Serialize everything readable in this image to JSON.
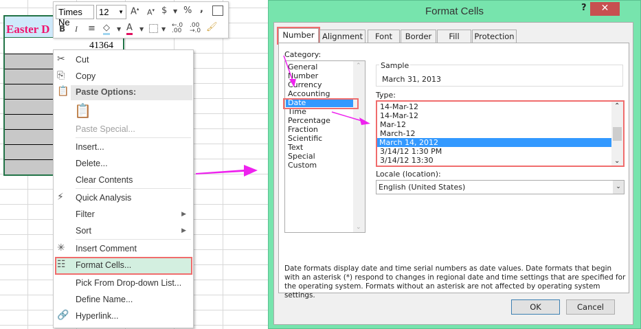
{
  "sheet": {
    "header_text": "Easter D",
    "cell_value": "41364"
  },
  "toolbar": {
    "font_name": "Times Ne",
    "font_size": "12",
    "buttons": [
      "increase-font",
      "decrease-font",
      "accounting-format",
      "percent-style",
      "comma-style",
      "format-table",
      "bold",
      "italic",
      "center",
      "fill-color",
      "font-color",
      "borders",
      "increase-decimal",
      "decrease-decimal",
      "format-painter"
    ],
    "labels": {
      "bold": "B",
      "italic": "I",
      "dollar": "$",
      "percent": "%",
      "comma": ","
    }
  },
  "context_menu": {
    "items": [
      {
        "label": "Cut",
        "icon": "scissors-icon"
      },
      {
        "label": "Copy",
        "icon": "copy-icon"
      },
      {
        "label": "Paste Options:",
        "icon": "paste-icon"
      },
      {
        "label": "Paste Special...",
        "disabled": true
      },
      {
        "label": "Insert..."
      },
      {
        "label": "Delete..."
      },
      {
        "label": "Clear Contents"
      },
      {
        "label": "Quick Analysis",
        "icon": "quick-analysis-icon"
      },
      {
        "label": "Filter",
        "submenu": true
      },
      {
        "label": "Sort",
        "submenu": true
      },
      {
        "label": "Insert Comment",
        "icon": "comment-icon"
      },
      {
        "label": "Format Cells...",
        "icon": "format-cells-icon",
        "highlighted": true
      },
      {
        "label": "Pick From Drop-down List..."
      },
      {
        "label": "Define Name..."
      },
      {
        "label": "Hyperlink...",
        "icon": "hyperlink-icon"
      }
    ]
  },
  "dialog": {
    "title": "Format Cells",
    "help": "?",
    "close": "✕",
    "tabs": [
      "Number",
      "Alignment",
      "Font",
      "Border",
      "Fill",
      "Protection"
    ],
    "active_tab": "Number",
    "category_label": "Category:",
    "categories": [
      "General",
      "Number",
      "Currency",
      "Accounting",
      "Date",
      "Time",
      "Percentage",
      "Fraction",
      "Scientific",
      "Text",
      "Special",
      "Custom"
    ],
    "selected_category": "Date",
    "sample_label": "Sample",
    "sample_value": "March 31, 2013",
    "type_label": "Type:",
    "types": [
      "14-Mar-12",
      "14-Mar-12",
      "Mar-12",
      "March-12",
      "March 14, 2012",
      "3/14/12 1:30 PM",
      "3/14/12 13:30"
    ],
    "selected_type": "March 14, 2012",
    "locale_label": "Locale (location):",
    "locale_value": "English (United States)",
    "description": "Date formats display date and time serial numbers as date values.  Date formats that begin with an asterisk (*) respond to changes in regional date and time settings that are specified for the operating system. Formats without an asterisk are not affected by operating system settings.",
    "ok": "OK",
    "cancel": "Cancel"
  },
  "colors": {
    "highlight_box": "#f06c6c",
    "arrow": "#ee22ee",
    "dialog_frame": "#77e4ad",
    "selection": "#3399ff",
    "format_cells_bg": "#d3efe0"
  }
}
